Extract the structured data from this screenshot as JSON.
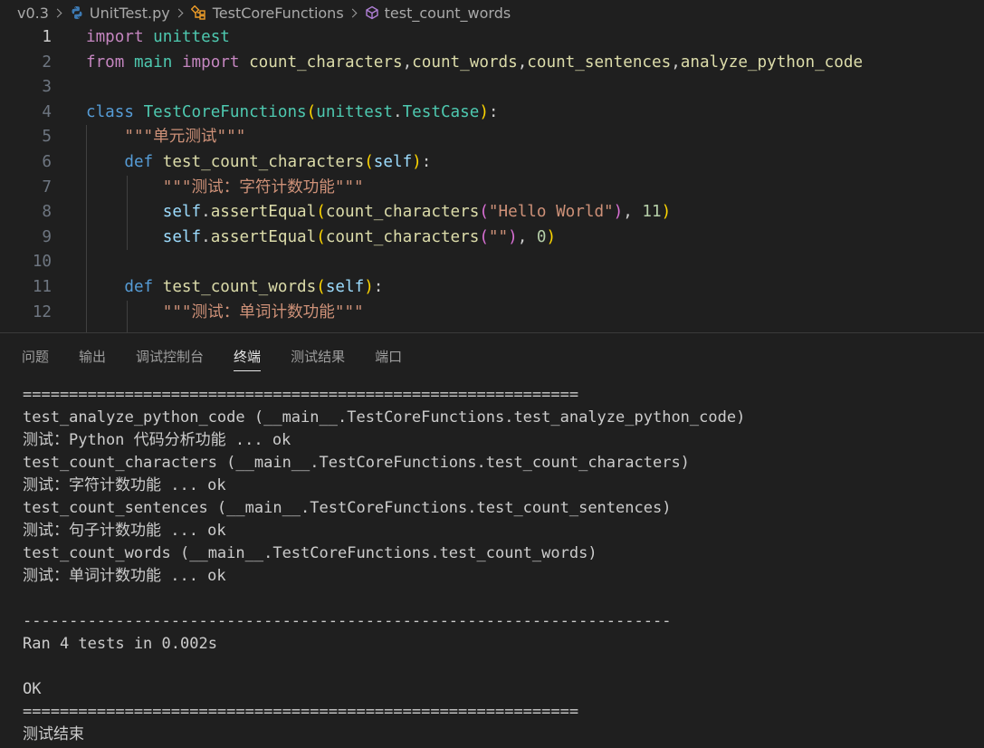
{
  "breadcrumb": {
    "items": [
      "v0.3",
      "UnitTest.py",
      "TestCoreFunctions",
      "test_count_words"
    ]
  },
  "editor": {
    "active_line": 1,
    "lines": [
      {
        "n": "1",
        "tokens": [
          {
            "c": "imp",
            "t": "import"
          },
          {
            "c": "plain",
            "t": " "
          },
          {
            "c": "cls",
            "t": "unittest"
          }
        ]
      },
      {
        "n": "2",
        "tokens": [
          {
            "c": "imp",
            "t": "from"
          },
          {
            "c": "plain",
            "t": " "
          },
          {
            "c": "cls",
            "t": "main"
          },
          {
            "c": "plain",
            "t": " "
          },
          {
            "c": "imp",
            "t": "import"
          },
          {
            "c": "plain",
            "t": " "
          },
          {
            "c": "fn",
            "t": "count_characters"
          },
          {
            "c": "plain",
            "t": ","
          },
          {
            "c": "fn",
            "t": "count_words"
          },
          {
            "c": "plain",
            "t": ","
          },
          {
            "c": "fn",
            "t": "count_sentences"
          },
          {
            "c": "plain",
            "t": ","
          },
          {
            "c": "fn",
            "t": "analyze_python_code"
          }
        ]
      },
      {
        "n": "3",
        "tokens": []
      },
      {
        "n": "4",
        "tokens": [
          {
            "c": "kw",
            "t": "class"
          },
          {
            "c": "plain",
            "t": " "
          },
          {
            "c": "cls",
            "t": "TestCoreFunctions"
          },
          {
            "c": "p1",
            "t": "("
          },
          {
            "c": "cls",
            "t": "unittest"
          },
          {
            "c": "plain",
            "t": "."
          },
          {
            "c": "cls",
            "t": "TestCase"
          },
          {
            "c": "p1",
            "t": ")"
          },
          {
            "c": "plain",
            "t": ":"
          }
        ]
      },
      {
        "n": "5",
        "tokens": [
          {
            "c": "plain",
            "t": "    "
          },
          {
            "c": "str",
            "t": "\"\"\"单元测试\"\"\""
          }
        ]
      },
      {
        "n": "6",
        "tokens": [
          {
            "c": "plain",
            "t": "    "
          },
          {
            "c": "kw",
            "t": "def"
          },
          {
            "c": "plain",
            "t": " "
          },
          {
            "c": "fn",
            "t": "test_count_characters"
          },
          {
            "c": "p1",
            "t": "("
          },
          {
            "c": "var",
            "t": "self"
          },
          {
            "c": "p1",
            "t": ")"
          },
          {
            "c": "plain",
            "t": ":"
          }
        ]
      },
      {
        "n": "7",
        "tokens": [
          {
            "c": "plain",
            "t": "        "
          },
          {
            "c": "str",
            "t": "\"\"\"测试：字符计数功能\"\"\""
          }
        ]
      },
      {
        "n": "8",
        "tokens": [
          {
            "c": "plain",
            "t": "        "
          },
          {
            "c": "var",
            "t": "self"
          },
          {
            "c": "plain",
            "t": "."
          },
          {
            "c": "fn",
            "t": "assertEqual"
          },
          {
            "c": "p1",
            "t": "("
          },
          {
            "c": "fn",
            "t": "count_characters"
          },
          {
            "c": "p2",
            "t": "("
          },
          {
            "c": "str",
            "t": "\"Hello World\""
          },
          {
            "c": "p2",
            "t": ")"
          },
          {
            "c": "plain",
            "t": ", "
          },
          {
            "c": "num",
            "t": "11"
          },
          {
            "c": "p1",
            "t": ")"
          }
        ]
      },
      {
        "n": "9",
        "tokens": [
          {
            "c": "plain",
            "t": "        "
          },
          {
            "c": "var",
            "t": "self"
          },
          {
            "c": "plain",
            "t": "."
          },
          {
            "c": "fn",
            "t": "assertEqual"
          },
          {
            "c": "p1",
            "t": "("
          },
          {
            "c": "fn",
            "t": "count_characters"
          },
          {
            "c": "p2",
            "t": "("
          },
          {
            "c": "str",
            "t": "\"\""
          },
          {
            "c": "p2",
            "t": ")"
          },
          {
            "c": "plain",
            "t": ", "
          },
          {
            "c": "num",
            "t": "0"
          },
          {
            "c": "p1",
            "t": ")"
          }
        ]
      },
      {
        "n": "10",
        "tokens": []
      },
      {
        "n": "11",
        "tokens": [
          {
            "c": "plain",
            "t": "    "
          },
          {
            "c": "kw",
            "t": "def"
          },
          {
            "c": "plain",
            "t": " "
          },
          {
            "c": "fn",
            "t": "test_count_words"
          },
          {
            "c": "p1",
            "t": "("
          },
          {
            "c": "var",
            "t": "self"
          },
          {
            "c": "p1",
            "t": ")"
          },
          {
            "c": "plain",
            "t": ":"
          }
        ]
      },
      {
        "n": "12",
        "tokens": [
          {
            "c": "plain",
            "t": "        "
          },
          {
            "c": "str",
            "t": "\"\"\"测试：单词计数功能\"\"\""
          }
        ]
      }
    ]
  },
  "panel": {
    "tabs": [
      {
        "label": "问题",
        "active": false
      },
      {
        "label": "输出",
        "active": false
      },
      {
        "label": "调试控制台",
        "active": false
      },
      {
        "label": "终端",
        "active": true
      },
      {
        "label": "测试结果",
        "active": false
      },
      {
        "label": "端口",
        "active": false
      }
    ]
  },
  "terminal": {
    "lines": [
      "============================================================",
      "test_analyze_python_code (__main__.TestCoreFunctions.test_analyze_python_code)",
      "测试：Python 代码分析功能 ... ok",
      "test_count_characters (__main__.TestCoreFunctions.test_count_characters)",
      "测试：字符计数功能 ... ok",
      "test_count_sentences (__main__.TestCoreFunctions.test_count_sentences)",
      "测试：句子计数功能 ... ok",
      "test_count_words (__main__.TestCoreFunctions.test_count_words)",
      "测试：单词计数功能 ... ok",
      "",
      "----------------------------------------------------------------------",
      "Ran 4 tests in 0.002s",
      "",
      "OK",
      "============================================================",
      "测试结束"
    ]
  },
  "icons": {
    "python": "python-file-icon",
    "class": "class-symbol-icon",
    "method": "method-symbol-icon"
  },
  "colors": {
    "background": "#1f1f1f",
    "keyword": "#569cd6",
    "import": "#c586c0",
    "class": "#4ec9b0",
    "function": "#dcdcaa",
    "string": "#ce9178",
    "number": "#b5cea8",
    "variable": "#9cdcfe"
  }
}
